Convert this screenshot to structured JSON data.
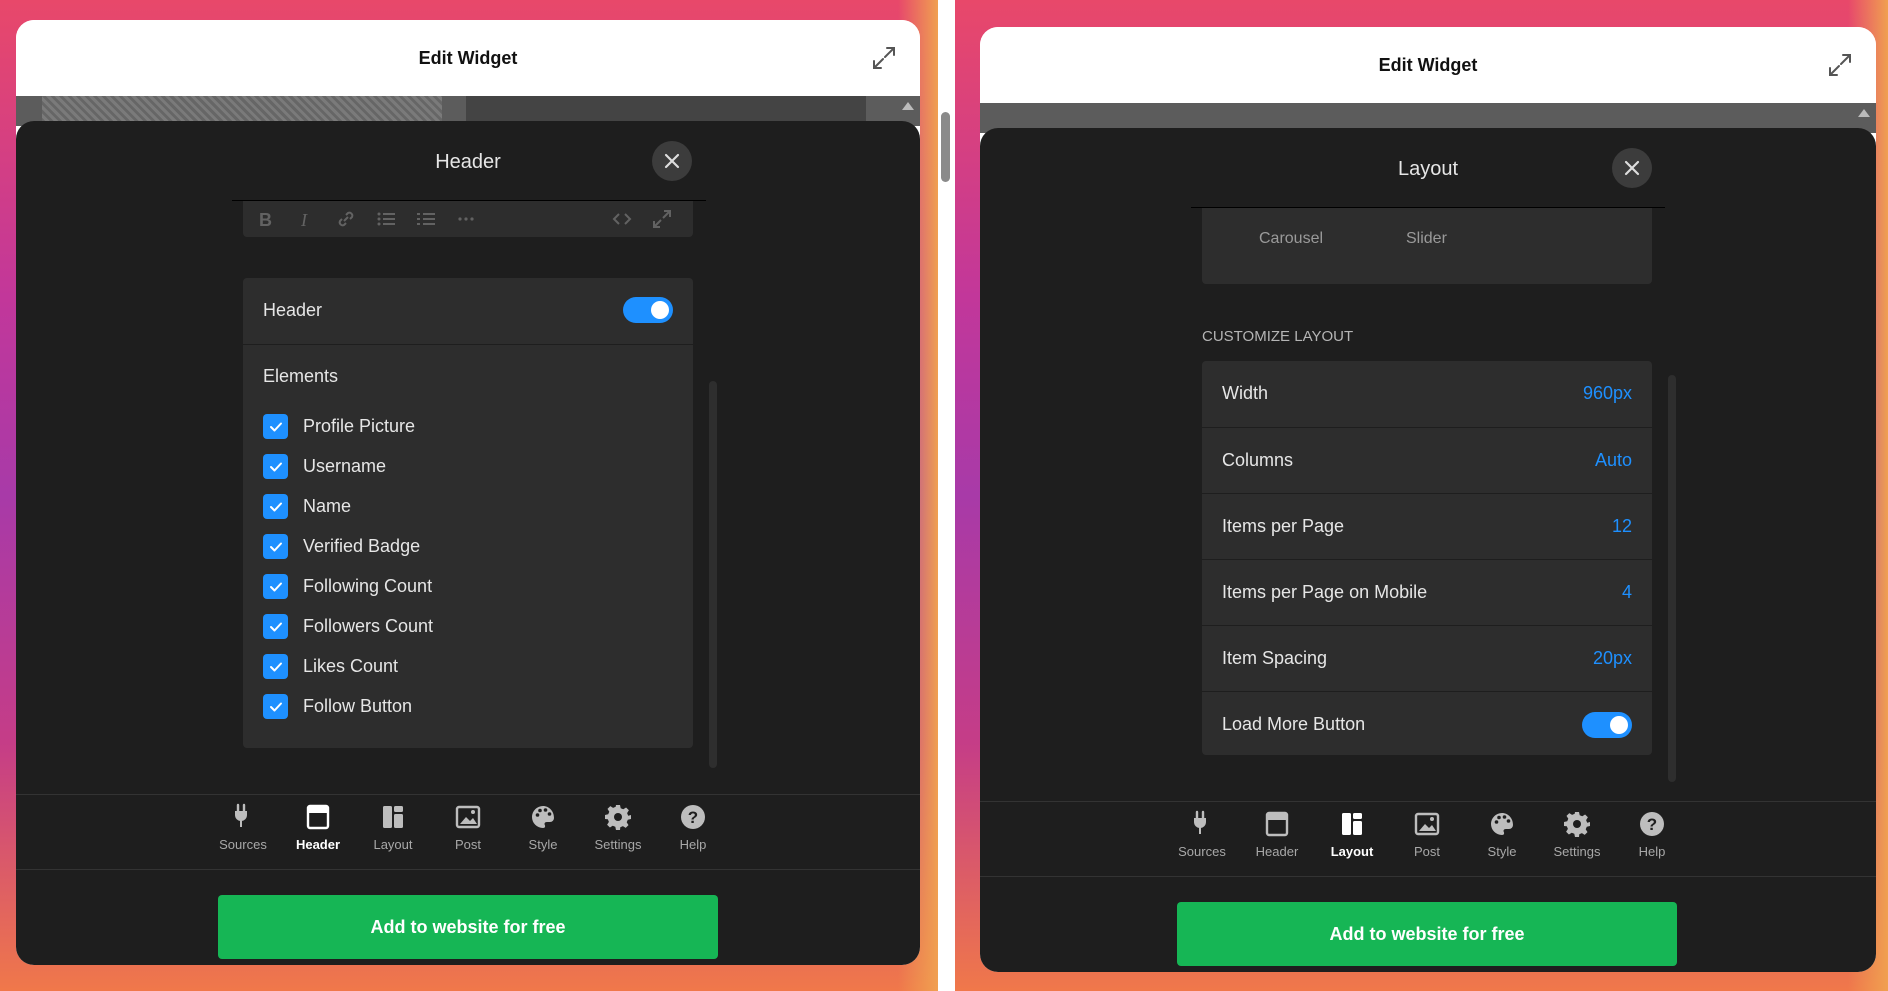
{
  "colors": {
    "accent": "#1e90ff",
    "cta": "#16b655",
    "panel": "#1e1e1e",
    "card": "#2d2d2d"
  },
  "left": {
    "window_title": "Edit Widget",
    "panel_title": "Header",
    "header_toggle": {
      "label": "Header",
      "on": true
    },
    "elements_heading": "Elements",
    "elements": [
      {
        "label": "Profile Picture",
        "checked": true
      },
      {
        "label": "Username",
        "checked": true
      },
      {
        "label": "Name",
        "checked": true
      },
      {
        "label": "Verified Badge",
        "checked": true
      },
      {
        "label": "Following Count",
        "checked": true
      },
      {
        "label": "Followers Count",
        "checked": true
      },
      {
        "label": "Likes Count",
        "checked": true
      },
      {
        "label": "Follow Button",
        "checked": true
      }
    ],
    "active_tab": "Header",
    "cta_label": "Add to website for free"
  },
  "right": {
    "window_title": "Edit Widget",
    "panel_title": "Layout",
    "layout_options": [
      "Carousel",
      "Slider"
    ],
    "section_caption": "CUSTOMIZE LAYOUT",
    "rows": [
      {
        "label": "Width",
        "value": "960px"
      },
      {
        "label": "Columns",
        "value": "Auto"
      },
      {
        "label": "Items per Page",
        "value": "12"
      },
      {
        "label": "Items per Page on Mobile",
        "value": "4"
      },
      {
        "label": "Item Spacing",
        "value": "20px"
      }
    ],
    "load_more": {
      "label": "Load More Button",
      "on": true
    },
    "active_tab": "Layout",
    "cta_label": "Add to website for free"
  },
  "tabs": [
    {
      "label": "Sources",
      "icon": "plug-icon"
    },
    {
      "label": "Header",
      "icon": "header-icon"
    },
    {
      "label": "Layout",
      "icon": "layout-icon"
    },
    {
      "label": "Post",
      "icon": "image-icon"
    },
    {
      "label": "Style",
      "icon": "palette-icon"
    },
    {
      "label": "Settings",
      "icon": "gear-icon"
    },
    {
      "label": "Help",
      "icon": "help-icon"
    }
  ]
}
